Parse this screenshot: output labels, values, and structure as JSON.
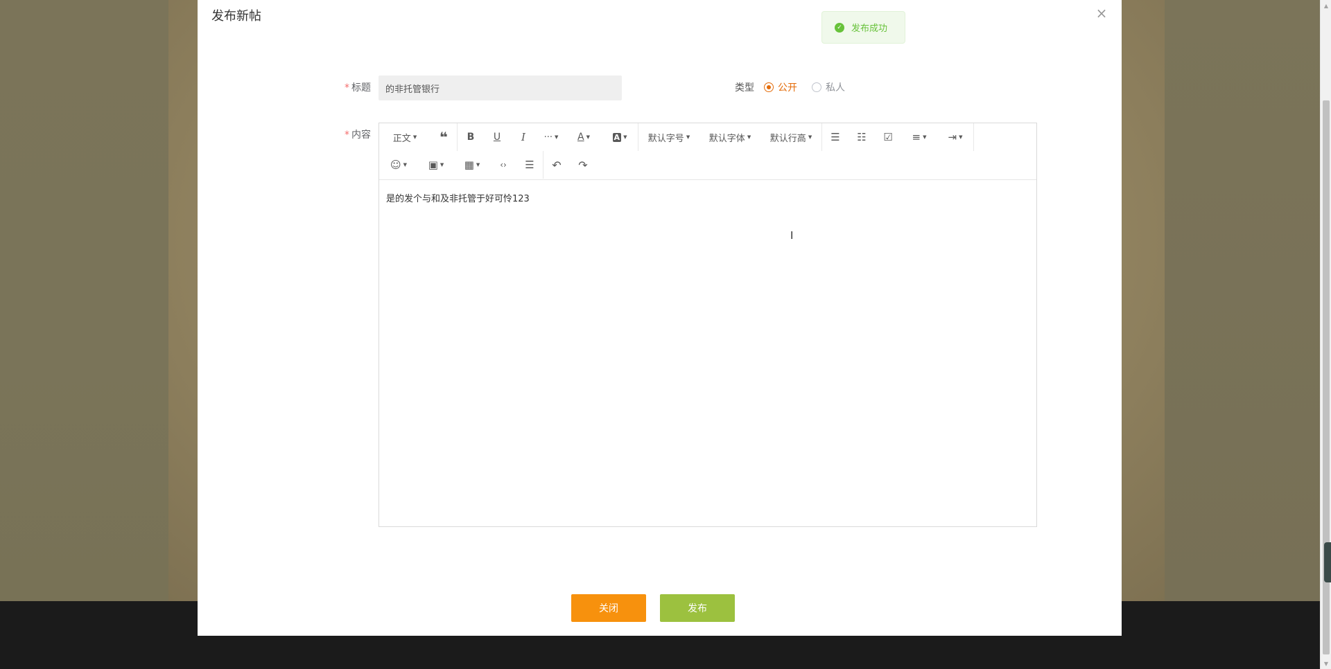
{
  "modal": {
    "title": "发布新帖",
    "close_symbol": "×"
  },
  "toast": {
    "icon": "check-circle-icon",
    "message": "发布成功",
    "color": "#67c23a"
  },
  "form": {
    "title_label": "标题",
    "title_value": "的非托管银行",
    "content_label": "内容",
    "required_mark": "*",
    "type_label": "类型",
    "type_options": [
      {
        "label": "公开",
        "checked": true
      },
      {
        "label": "私人",
        "checked": false
      }
    ]
  },
  "editor": {
    "toolbar_row1": [
      {
        "name": "paragraph-style",
        "label": "正文",
        "dropdown": true
      },
      {
        "name": "quote",
        "label": "❝",
        "dropdown": false
      },
      {
        "name": "bold",
        "label": "B",
        "dropdown": false
      },
      {
        "name": "underline",
        "label": "U",
        "dropdown": false
      },
      {
        "name": "italic",
        "label": "I",
        "dropdown": false
      },
      {
        "name": "more",
        "label": "···",
        "dropdown": true
      },
      {
        "name": "font-color",
        "label": "A",
        "dropdown": true
      },
      {
        "name": "bg-color",
        "label": "A",
        "dropdown": true
      },
      {
        "name": "font-size",
        "label": "默认字号",
        "dropdown": true
      },
      {
        "name": "font-family",
        "label": "默认字体",
        "dropdown": true
      },
      {
        "name": "line-height",
        "label": "默认行高",
        "dropdown": true
      },
      {
        "name": "bulleted-list",
        "label": "☰",
        "dropdown": false
      },
      {
        "name": "numbered-list",
        "label": "☷",
        "dropdown": false
      },
      {
        "name": "todo",
        "label": "☑",
        "dropdown": false
      },
      {
        "name": "align",
        "label": "≡",
        "dropdown": true
      },
      {
        "name": "indent",
        "label": "⇥",
        "dropdown": true
      }
    ],
    "toolbar_row2": [
      {
        "name": "emoji",
        "label": "☺",
        "dropdown": true
      },
      {
        "name": "image",
        "label": "▣",
        "dropdown": true
      },
      {
        "name": "table",
        "label": "▦",
        "dropdown": true
      },
      {
        "name": "code",
        "label": "‹›",
        "dropdown": false
      },
      {
        "name": "divider",
        "label": "☰",
        "dropdown": false
      },
      {
        "name": "undo",
        "label": "↶",
        "dropdown": false
      },
      {
        "name": "redo",
        "label": "↷",
        "dropdown": false
      }
    ],
    "content": "是的发个与和及非托管于好可怜123"
  },
  "buttons": {
    "close_label": "关闭",
    "publish_label": "发布"
  },
  "colors": {
    "accent": "#e46c0a",
    "close_button": "#f7910d",
    "publish_button": "#9cc13f"
  }
}
